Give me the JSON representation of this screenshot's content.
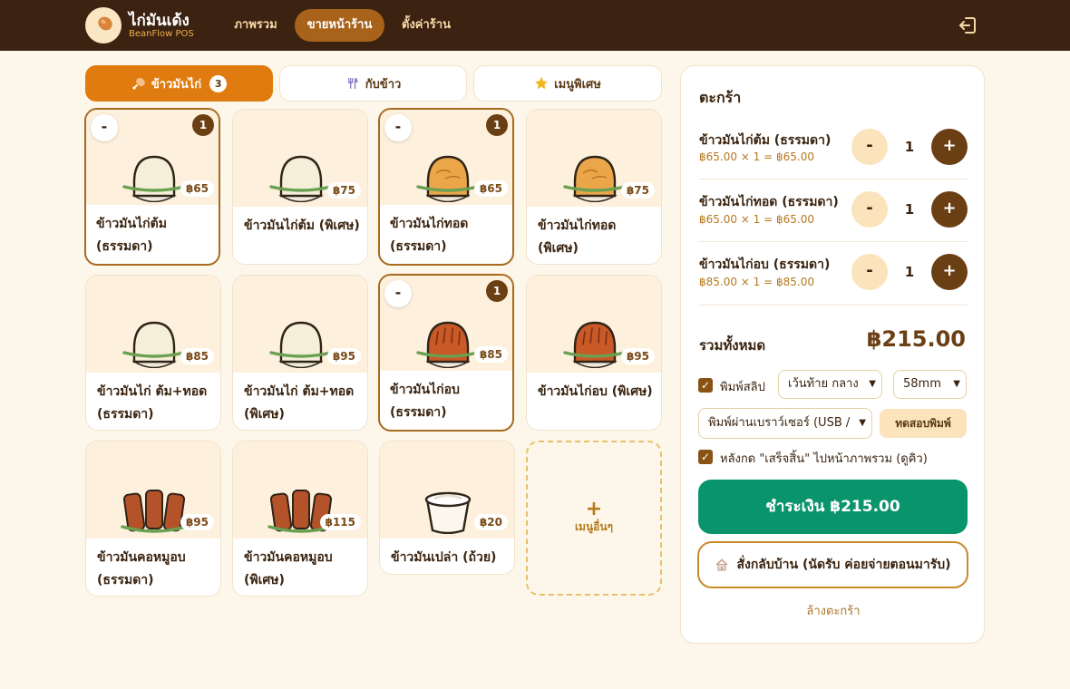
{
  "app": {
    "name": "ไก่มันเด้ง",
    "subtitle": "BeanFlow POS",
    "nav": [
      {
        "label": "ภาพรวม",
        "active": false
      },
      {
        "label": "ขายหน้าร้าน",
        "active": true
      },
      {
        "label": "ตั้งค่าร้าน",
        "active": false
      }
    ]
  },
  "categories": [
    {
      "label": "ข้าวมันไก่",
      "icon": "drumstick-icon",
      "badge": "3",
      "active": true
    },
    {
      "label": "กับข้าว",
      "icon": "utensils-icon",
      "active": false
    },
    {
      "label": "เมนูพิเศษ",
      "icon": "star-icon",
      "active": false
    }
  ],
  "products": [
    {
      "name": "ข้าวมันไก่ต้ม (ธรรมดา)",
      "price": "฿65",
      "icon": "boiled-chicken-rice-icon",
      "qty": "1",
      "minus": "-"
    },
    {
      "name": "ข้าวมันไก่ต้ม (พิเศษ)",
      "price": "฿75",
      "icon": "boiled-chicken-rice-icon"
    },
    {
      "name": "ข้าวมันไก่ทอด (ธรรมดา)",
      "price": "฿65",
      "icon": "fried-chicken-rice-icon",
      "qty": "1",
      "minus": "-"
    },
    {
      "name": "ข้าวมันไก่ทอด (พิเศษ)",
      "price": "฿75",
      "icon": "fried-chicken-rice-icon"
    },
    {
      "name": "ข้าวมันไก่ ต้ม+ทอด (ธรรมดา)",
      "price": "฿85",
      "icon": "boiled-chicken-rice-icon"
    },
    {
      "name": "ข้าวมันไก่ ต้ม+ทอด (พิเศษ)",
      "price": "฿95",
      "icon": "boiled-chicken-rice-icon"
    },
    {
      "name": "ข้าวมันไก่อบ (ธรรมดา)",
      "price": "฿85",
      "icon": "roast-chicken-rice-icon",
      "qty": "1",
      "minus": "-"
    },
    {
      "name": "ข้าวมันไก่อบ (พิเศษ)",
      "price": "฿95",
      "icon": "roast-chicken-rice-icon"
    },
    {
      "name": "ข้าวมันคอหมูอบ (ธรรมดา)",
      "price": "฿95",
      "icon": "grilled-pork-neck-icon"
    },
    {
      "name": "ข้าวมันคอหมูอบ (พิเศษ)",
      "price": "฿115",
      "icon": "grilled-pork-neck-icon"
    },
    {
      "name": "ข้าวมันเปล่า (ถ้วย)",
      "price": "฿20",
      "icon": "rice-cup-icon"
    }
  ],
  "more_menu": {
    "plus": "+",
    "label": "เมนูอื่นๆ"
  },
  "cart": {
    "title": "ตะกร้า",
    "items": [
      {
        "name": "ข้าวมันไก่ต้ม (ธรรมดา)",
        "detail": "฿65.00 × 1 = ฿65.00",
        "qty": "1"
      },
      {
        "name": "ข้าวมันไก่ทอด (ธรรมดา)",
        "detail": "฿65.00 × 1 = ฿65.00",
        "qty": "1"
      },
      {
        "name": "ข้าวมันไก่อบ (ธรรมดา)",
        "detail": "฿85.00 × 1 = ฿85.00",
        "qty": "1"
      }
    ],
    "minus": "-",
    "plus": "+",
    "total_label": "รวมทั้งหมด",
    "total_value": "฿215.00",
    "print_slip_label": "พิมพ์สลิป",
    "print_slip_checked": true,
    "margin_select": "เว้นท้าย กลาง",
    "paper_select": "58mm",
    "printer_select": "พิมพ์ผ่านเบราว์เซอร์ (USB / ",
    "test_print": "ทดสอบพิมพ์",
    "goto_overview_label": "หลังกด \"เสร็จสิ้น\" ไปหน้าภาพรวม (ดูคิว)",
    "goto_overview_checked": true,
    "pay_button": "ชำระเงิน ฿215.00",
    "takeaway_button": "สั่งกลับบ้าน (นัดรับ ค่อยจ่ายตอนมารับ)",
    "clear_button": "ล้างตะกร้า"
  },
  "colors": {
    "topbar": "#3c2210",
    "accent": "#e07c0f",
    "pay": "#0a946c",
    "brown": "#6b3f14"
  }
}
